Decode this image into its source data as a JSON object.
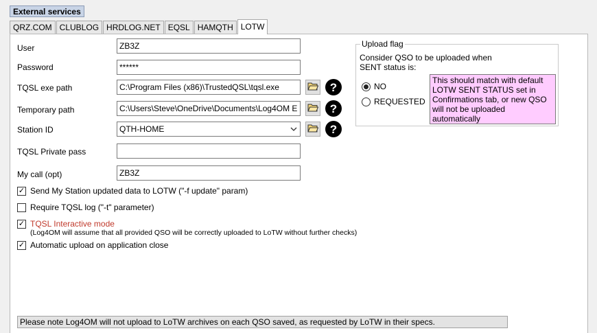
{
  "section_title": "External services",
  "tabs": [
    {
      "label": "QRZ.COM"
    },
    {
      "label": "CLUBLOG"
    },
    {
      "label": "HRDLOG.NET"
    },
    {
      "label": "EQSL"
    },
    {
      "label": "HAMQTH"
    },
    {
      "label": "LOTW",
      "active": true
    }
  ],
  "form": {
    "user_label": "User",
    "user_value": "ZB3Z",
    "password_label": "Password",
    "password_value": "******",
    "tqsl_exe_label": "TQSL exe path",
    "tqsl_exe_value": "C:\\Program Files (x86)\\TrustedQSL\\tqsl.exe",
    "temp_path_label": "Temporary path",
    "temp_path_value": "C:\\Users\\Steve\\OneDrive\\Documents\\Log4OM E",
    "station_id_label": "Station ID",
    "station_id_value": "QTH-HOME",
    "tqsl_pass_label": "TQSL Private pass",
    "tqsl_pass_value": "",
    "my_call_label": "My call (opt)",
    "my_call_value": "ZB3Z"
  },
  "checkboxes": {
    "send_station": {
      "label": "Send My Station updated data to LOTW (\"-f update\" param)",
      "checked": true
    },
    "require_log": {
      "label": "Require TQSL log (\"-t\" parameter)",
      "checked": false
    },
    "interactive": {
      "label": "TQSL Interactive mode",
      "checked": true,
      "note": "(Log4OM will assume that all provided QSO will be correctly uploaded to LoTW without further checks)"
    },
    "auto_upload": {
      "label": "Automatic upload on application close",
      "checked": true
    }
  },
  "upload_flag": {
    "title": "Upload flag",
    "line1": "Consider QSO to be uploaded when",
    "line2": "SENT status is:",
    "option_no": "NO",
    "option_requested": "REQUESTED",
    "selected": "NO",
    "note": "This should match with default LOTW SENT STATUS set in Confirmations tab, or new QSO will not be uploaded automatically"
  },
  "bottom_note": "Please note Log4OM will not upload to LoTW archives on each QSO saved, as requested by LoTW in their specs.",
  "colors": {
    "pink_note_bg": "#ffccff",
    "interactive_label": "#c0392b",
    "title_bg": "#c8d4e6"
  },
  "icons": {
    "folder": "folder-open-icon",
    "help": "question-circle-icon",
    "dropdown": "chevron-down-icon"
  }
}
